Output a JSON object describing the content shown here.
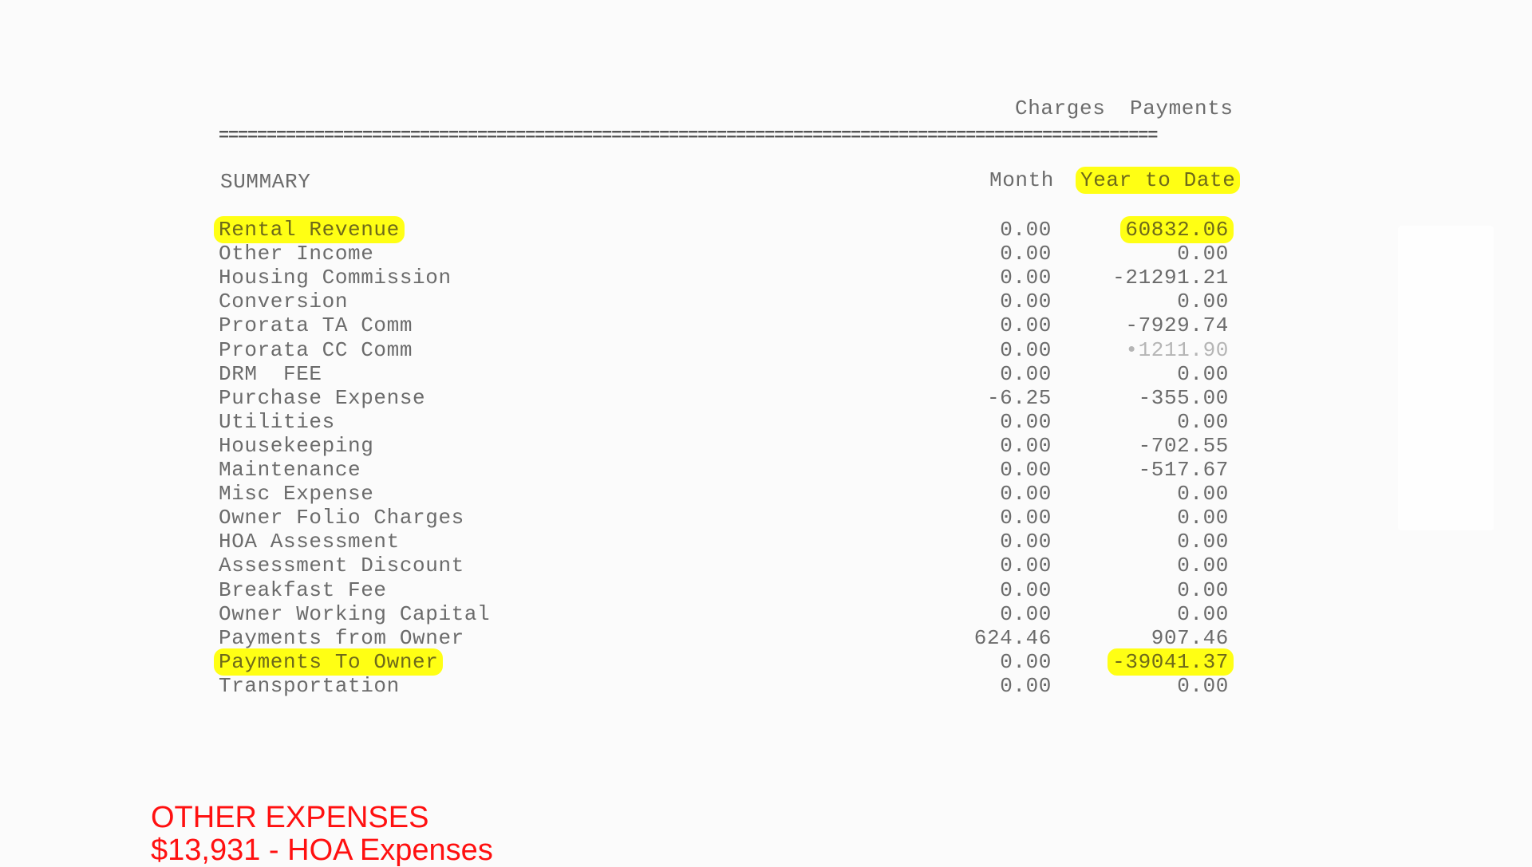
{
  "header": {
    "col_charges": "Charges",
    "col_payments": "Payments",
    "rule": "=================================================================================================="
  },
  "summary": {
    "title": "SUMMARY",
    "col_month": "Month",
    "col_ytd": "Year to Date",
    "highlight_color": "#ffff14",
    "rows": [
      {
        "label": "Rental Revenue",
        "month": "0.00",
        "ytd": "60832.06",
        "highlighted": true
      },
      {
        "label": "Other Income",
        "month": "0.00",
        "ytd": "0.00"
      },
      {
        "label": "Housing Commission",
        "month": "0.00",
        "ytd": "-21291.21"
      },
      {
        "label": "Conversion",
        "month": "0.00",
        "ytd": "0.00"
      },
      {
        "label": "Prorata TA Comm",
        "month": "0.00",
        "ytd": "-7929.74"
      },
      {
        "label": "Prorata CC Comm",
        "month": "0.00",
        "ytd": "•1211.90"
      },
      {
        "label": "DRM  FEE",
        "month": "0.00",
        "ytd": "0.00"
      },
      {
        "label": "Purchase Expense",
        "month": "-6.25",
        "ytd": "-355.00"
      },
      {
        "label": "Utilities",
        "month": "0.00",
        "ytd": "0.00"
      },
      {
        "label": "Housekeeping",
        "month": "0.00",
        "ytd": "-702.55"
      },
      {
        "label": "Maintenance",
        "month": "0.00",
        "ytd": "-517.67"
      },
      {
        "label": "Misc Expense",
        "month": "0.00",
        "ytd": "0.00"
      },
      {
        "label": "Owner Folio Charges",
        "month": "0.00",
        "ytd": "0.00"
      },
      {
        "label": "HOA Assessment",
        "month": "0.00",
        "ytd": "0.00"
      },
      {
        "label": "Assessment Discount",
        "month": "0.00",
        "ytd": "0.00"
      },
      {
        "label": "Breakfast Fee",
        "month": "0.00",
        "ytd": "0.00"
      },
      {
        "label": "Owner Working Capital",
        "month": "0.00",
        "ytd": "0.00"
      },
      {
        "label": "Payments from Owner",
        "month": "624.46",
        "ytd": "907.46"
      },
      {
        "label": "Payments To Owner",
        "month": "0.00",
        "ytd": "-39041.37",
        "highlighted": true
      },
      {
        "label": "Transportation",
        "month": "0.00",
        "ytd": "0.00"
      }
    ]
  },
  "annotation": {
    "title": "OTHER EXPENSES",
    "line1": "$13,931 - HOA Expenses",
    "color": "#ff1010"
  }
}
